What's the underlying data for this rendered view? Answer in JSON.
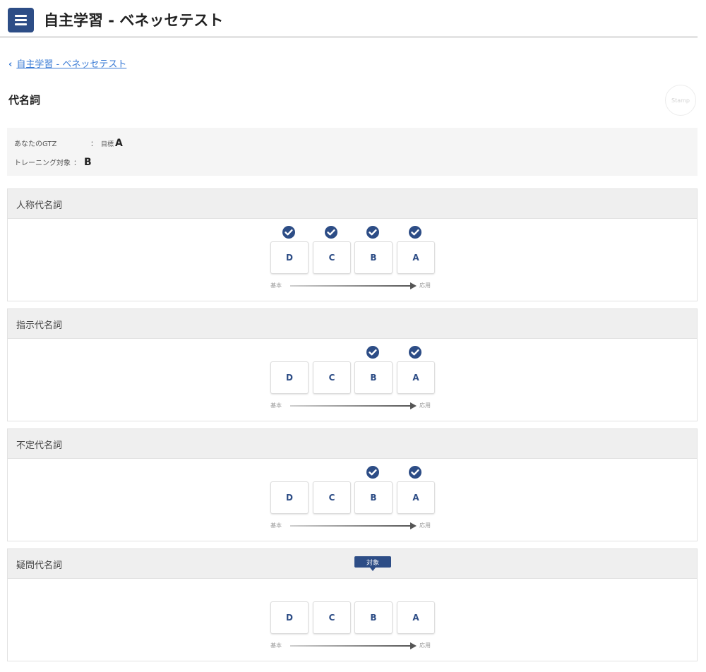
{
  "header": {
    "title": "自主学習 - ベネッセテスト",
    "menu_icon": "hamburger-menu-icon"
  },
  "breadcrumb": {
    "chevron": "‹",
    "link_label": "自主学習 - ベネッセテスト"
  },
  "page": {
    "title": "代名詞",
    "stamp_label": "Stamp"
  },
  "info": {
    "gtz_label": "あなたのGTZ",
    "gtz_separator": "：",
    "gtz_prefix": "目標",
    "gtz_value": "A",
    "training_label": "トレーニング対象",
    "training_separator": "：",
    "training_value": "B"
  },
  "levels": [
    "D",
    "C",
    "B",
    "A"
  ],
  "axis": {
    "start_label": "基本",
    "end_label": "応用"
  },
  "target_badge_label": "対象",
  "colors": {
    "accent": "#2d4d86",
    "link": "#3a7bd5",
    "panel_bg": "#efefef"
  },
  "sections": [
    {
      "title": "人称代名詞",
      "checked": [
        true,
        true,
        true,
        true
      ],
      "target": null
    },
    {
      "title": "指示代名詞",
      "checked": [
        false,
        false,
        true,
        true
      ],
      "target": null
    },
    {
      "title": "不定代名詞",
      "checked": [
        false,
        false,
        true,
        true
      ],
      "target": null
    },
    {
      "title": "疑問代名詞",
      "checked": [
        false,
        false,
        false,
        false
      ],
      "target": "B"
    }
  ]
}
